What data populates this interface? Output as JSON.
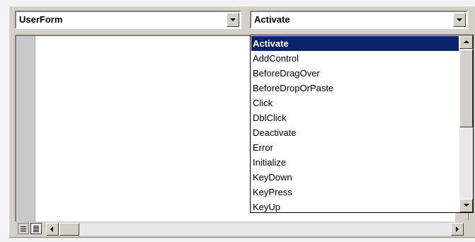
{
  "object_combo": {
    "value": "UserForm"
  },
  "procedure_combo": {
    "value": "Activate"
  },
  "procedure_list": {
    "items": [
      {
        "label": "Activate",
        "selected": true
      },
      {
        "label": "AddControl",
        "selected": false
      },
      {
        "label": "BeforeDragOver",
        "selected": false
      },
      {
        "label": "BeforeDropOrPaste",
        "selected": false
      },
      {
        "label": "Click",
        "selected": false
      },
      {
        "label": "DblClick",
        "selected": false
      },
      {
        "label": "Deactivate",
        "selected": false
      },
      {
        "label": "Error",
        "selected": false
      },
      {
        "label": "Initialize",
        "selected": false
      },
      {
        "label": "KeyDown",
        "selected": false
      },
      {
        "label": "KeyPress",
        "selected": false
      },
      {
        "label": "KeyUp",
        "selected": false
      }
    ]
  },
  "colors": {
    "selection": "#0a246a",
    "chrome": "#d4d0c8"
  },
  "icons": {
    "dropdown": "chevron-down-icon",
    "procedure_view": "procedure-view-icon",
    "full_module_view": "full-module-view-icon"
  }
}
